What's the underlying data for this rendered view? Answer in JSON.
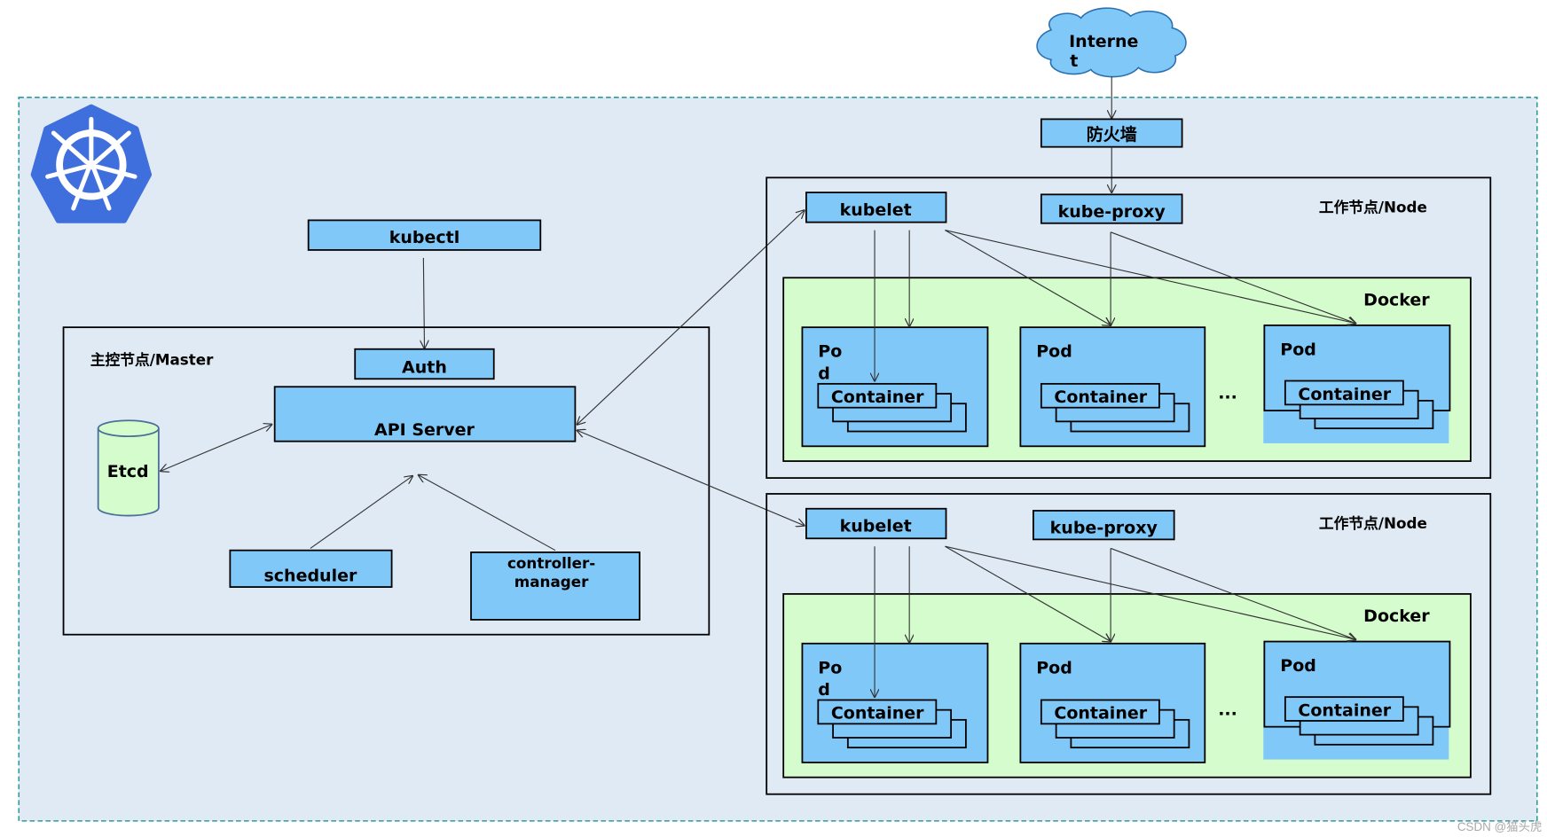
{
  "internet": {
    "line1": "Interne",
    "line2": "t"
  },
  "firewall": "防火墙",
  "kubectl": "kubectl",
  "master": {
    "label": "主控节点/Master",
    "auth": "Auth",
    "api_server": "API Server",
    "etcd": "Etcd",
    "scheduler": "scheduler",
    "controller_manager": {
      "line1": "controller-",
      "line2": "manager"
    }
  },
  "nodes": [
    {
      "label": "工作节点/Node",
      "kubelet": "kubelet",
      "kube_proxy": "kube-proxy",
      "docker": "Docker",
      "pods": [
        {
          "l1": "Po",
          "l2": "d",
          "container": "Container"
        },
        {
          "l1": "Pod",
          "container": "Container"
        },
        {
          "l1": "Pod",
          "container": "Container"
        }
      ],
      "ellipsis": "..."
    },
    {
      "label": "工作节点/Node",
      "kubelet": "kubelet",
      "kube_proxy": "kube-proxy",
      "docker": "Docker",
      "pods": [
        {
          "l1": "Po",
          "l2": "d",
          "container": "Container"
        },
        {
          "l1": "Pod",
          "container": "Container"
        },
        {
          "l1": "Pod",
          "container": "Container"
        }
      ],
      "ellipsis": "..."
    }
  ],
  "watermark": "CSDN @猫头虎",
  "colors": {
    "component": "#80c8f8",
    "cluster_bg": "#dfeaf5",
    "docker_bg": "#d5fccc",
    "cluster_border": "#2e9a9a",
    "logo": "#3f6fdc"
  },
  "icons": {
    "logo": "kubernetes-helm-icon",
    "cloud": "cloud-icon",
    "db": "database-cylinder-icon"
  }
}
